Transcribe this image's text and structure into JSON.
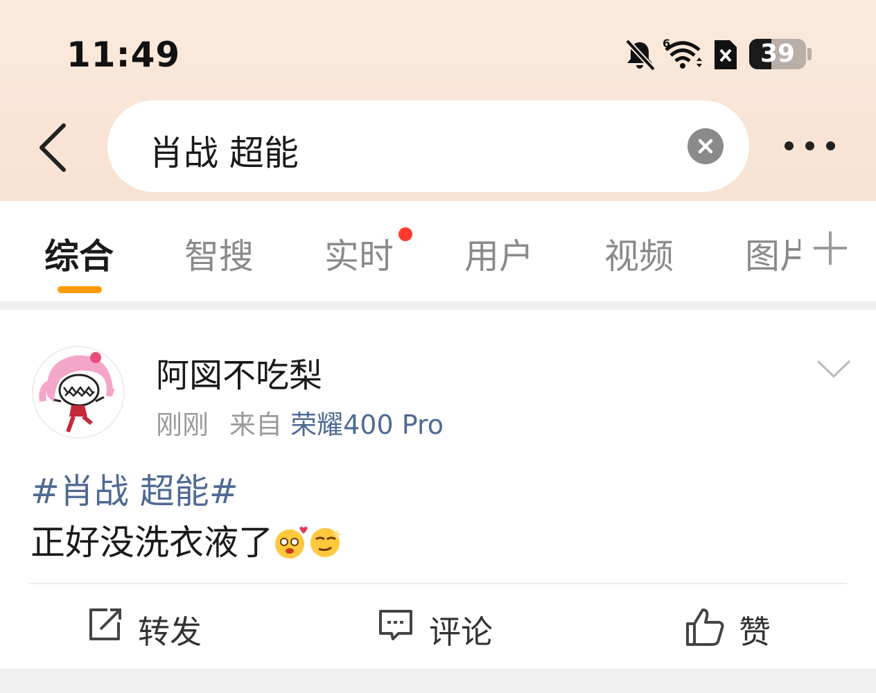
{
  "status_bar": {
    "time": "11:49",
    "battery_percent": "39",
    "battery_level": 0.39,
    "icons": [
      "bell-muted-icon",
      "wifi-icon",
      "sim-icon",
      "battery-icon"
    ]
  },
  "search": {
    "query": "肖战 超能"
  },
  "tabs": [
    {
      "label": "综合",
      "active": true
    },
    {
      "label": "智搜",
      "active": false
    },
    {
      "label": "实时",
      "active": false,
      "has_red_dot": true
    },
    {
      "label": "用户",
      "active": false
    },
    {
      "label": "视频",
      "active": false
    },
    {
      "label": "图片",
      "active": false
    }
  ],
  "post": {
    "username": "阿図不吃梨",
    "time": "刚刚",
    "source_prefix": "来自",
    "source": "荣耀400 Pro",
    "topic": "#肖战 超能#",
    "text": "正好没洗衣液了",
    "emojis": [
      "love-face-emoji",
      "smirk-face-emoji"
    ]
  },
  "actions": {
    "repost": "转发",
    "comment": "评论",
    "like": "赞"
  },
  "colors": {
    "accent": "#ff9900",
    "link": "#506a94",
    "red_dot": "#ff3b30",
    "header_bg": "#faeadd"
  }
}
